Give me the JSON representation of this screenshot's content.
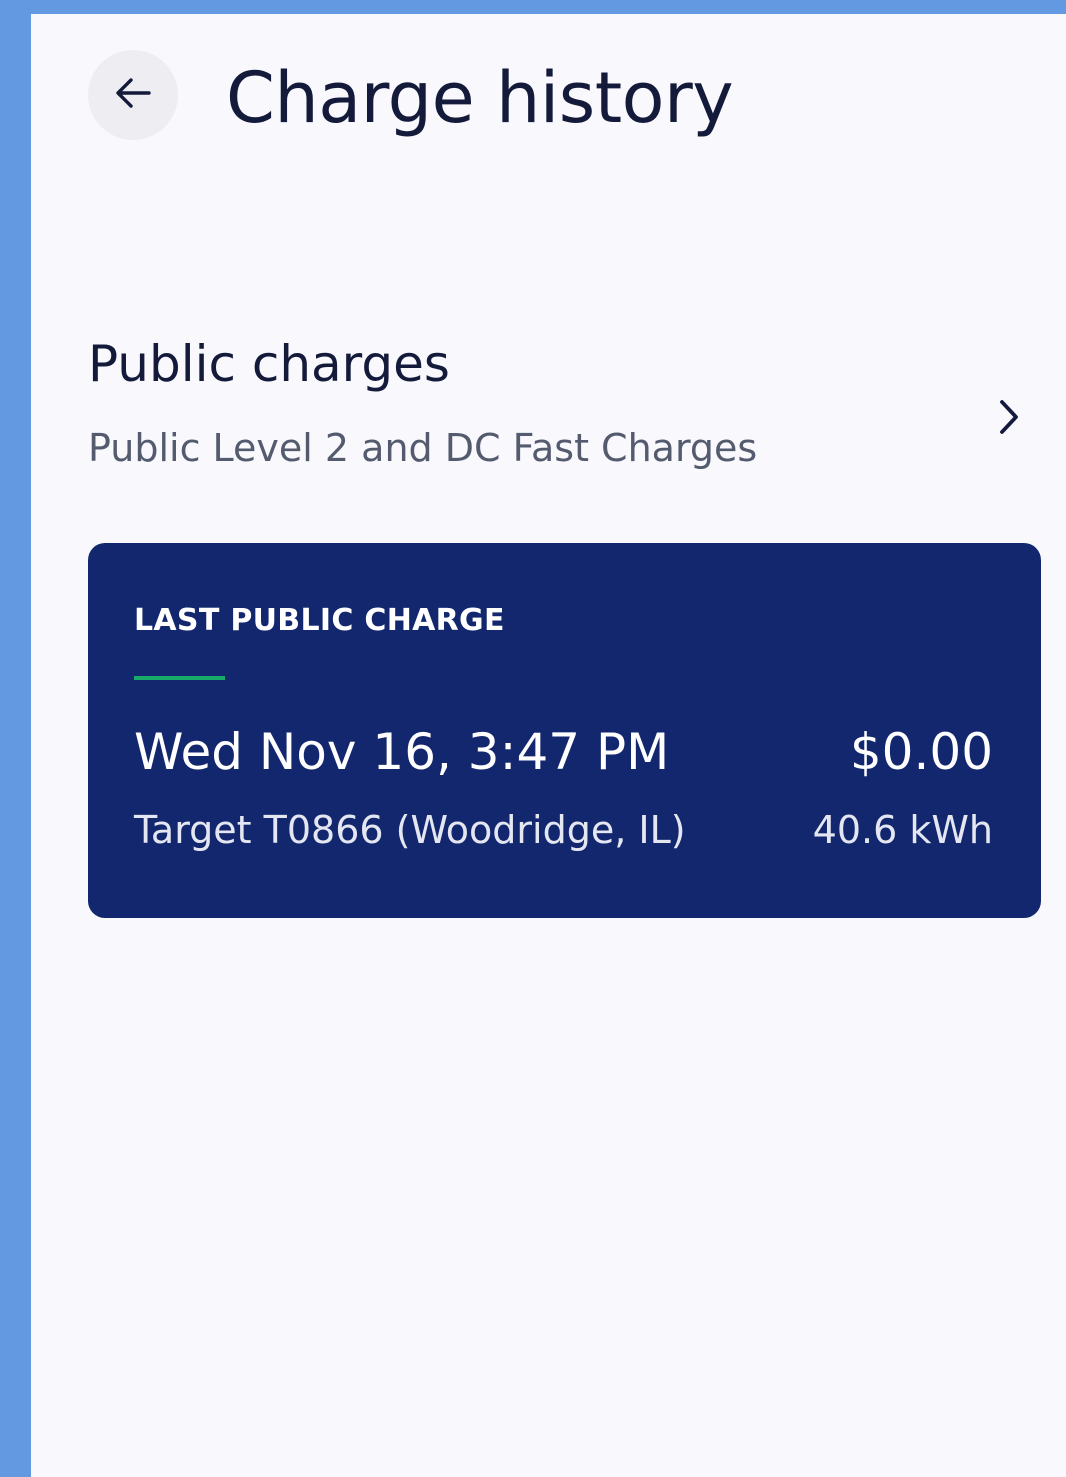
{
  "header": {
    "title": "Charge history",
    "back_icon": "arrow-left-icon"
  },
  "public_charges": {
    "title": "Public charges",
    "subtitle": "Public Level 2 and DC Fast Charges",
    "chevron_icon": "chevron-right-icon"
  },
  "last_charge": {
    "label": "LAST PUBLIC CHARGE",
    "datetime": "Wed Nov 16, 3:47 PM",
    "cost": "$0.00",
    "location": "Target T0866 (Woodridge, IL)",
    "energy": "40.6 kWh"
  },
  "colors": {
    "frame": "#6299e1",
    "background": "#f8f8fd",
    "card": "#13276f",
    "accent": "#19a96b",
    "text_primary": "#141a3a",
    "text_secondary": "#555b6f"
  }
}
